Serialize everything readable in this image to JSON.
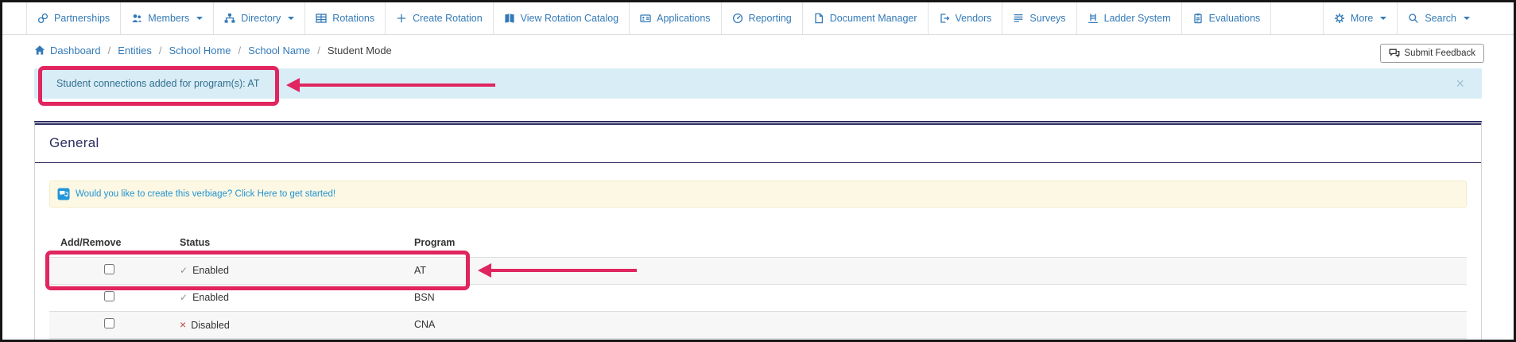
{
  "nav": {
    "items": [
      {
        "label": "Partnerships",
        "icon": "link-icon"
      },
      {
        "label": "Members",
        "icon": "members-icon",
        "caret": true
      },
      {
        "label": "Directory",
        "icon": "directory-icon",
        "caret": true
      },
      {
        "label": "Rotations",
        "icon": "table-icon"
      },
      {
        "label": "Create Rotation",
        "icon": "plus-icon"
      },
      {
        "label": "View Rotation Catalog",
        "icon": "book-icon"
      },
      {
        "label": "Applications",
        "icon": "id-card-icon"
      },
      {
        "label": "Reporting",
        "icon": "gauge-icon"
      },
      {
        "label": "Document Manager",
        "icon": "document-icon"
      },
      {
        "label": "Vendors",
        "icon": "sign-out-icon"
      },
      {
        "label": "Surveys",
        "icon": "survey-icon"
      },
      {
        "label": "Ladder System",
        "icon": "ladder-icon"
      },
      {
        "label": "Evaluations",
        "icon": "clipboard-icon"
      },
      {
        "label": "More",
        "icon": "gear-icon",
        "caret": true
      },
      {
        "label": "Search",
        "icon": "search-icon",
        "caret": true
      }
    ]
  },
  "breadcrumb": {
    "separator": "/",
    "items": [
      "Dashboard",
      "Entities",
      "School Home",
      "School Name"
    ],
    "current": "Student Mode"
  },
  "feedback_button": {
    "label": "Submit Feedback",
    "icon": "comments-icon"
  },
  "alert": {
    "message": "Student connections added for program(s): AT",
    "dismiss": "×"
  },
  "panel": {
    "title": "General",
    "verbiage_notice": "Would you like to create this verbiage? Click Here to get started!",
    "verbiage_icon": "chat-bubble-icon"
  },
  "table": {
    "headers": {
      "add_remove": "Add/Remove",
      "status": "Status",
      "program": "Program"
    },
    "rows": [
      {
        "status_icon": "✓",
        "status": "Enabled",
        "program": "AT",
        "highlighted": true
      },
      {
        "status_icon": "✓",
        "status": "Enabled",
        "program": "BSN",
        "highlighted": false
      },
      {
        "status_icon": "×",
        "status": "Disabled",
        "program": "CNA",
        "highlighted": false
      }
    ]
  },
  "colors": {
    "nav_link": "#337ab7",
    "alert_bg": "#d9edf7",
    "alert_text": "#31708f",
    "panel_accent": "#2e2d62",
    "annotation": "#e0255f",
    "verbiage_bg": "#fdf8e3",
    "verbiage_text": "#2093d5"
  }
}
